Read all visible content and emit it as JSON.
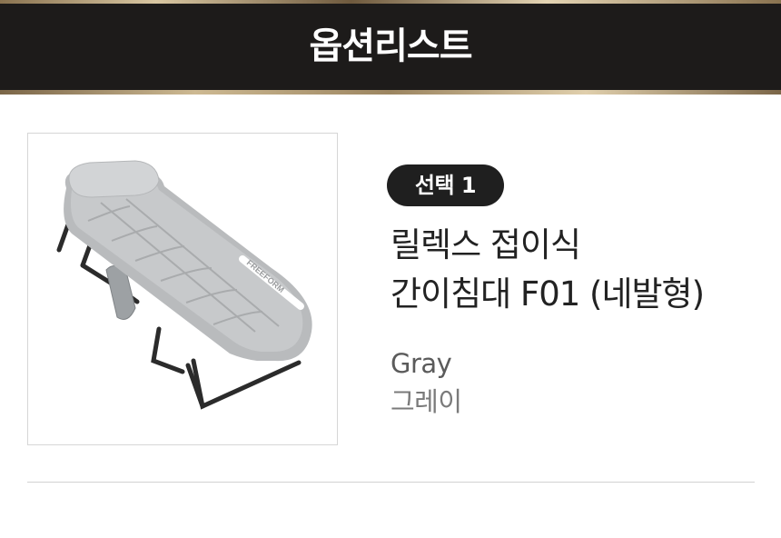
{
  "header": {
    "title": "옵션리스트"
  },
  "option": {
    "badge_label": "선택 1",
    "name_line1": "릴렉스 접이식",
    "name_line2": "간이침대 F01 (네발형)",
    "color_en": "Gray",
    "color_ko": "그레이",
    "image_icon": "folding-cot-image",
    "image_logo_text": "FREEFORM"
  },
  "colors": {
    "header_bg": "#1d1b1a",
    "badge_bg": "#1f1f1f",
    "text_dark": "#222222",
    "text_muted": "#7a7a7a"
  }
}
